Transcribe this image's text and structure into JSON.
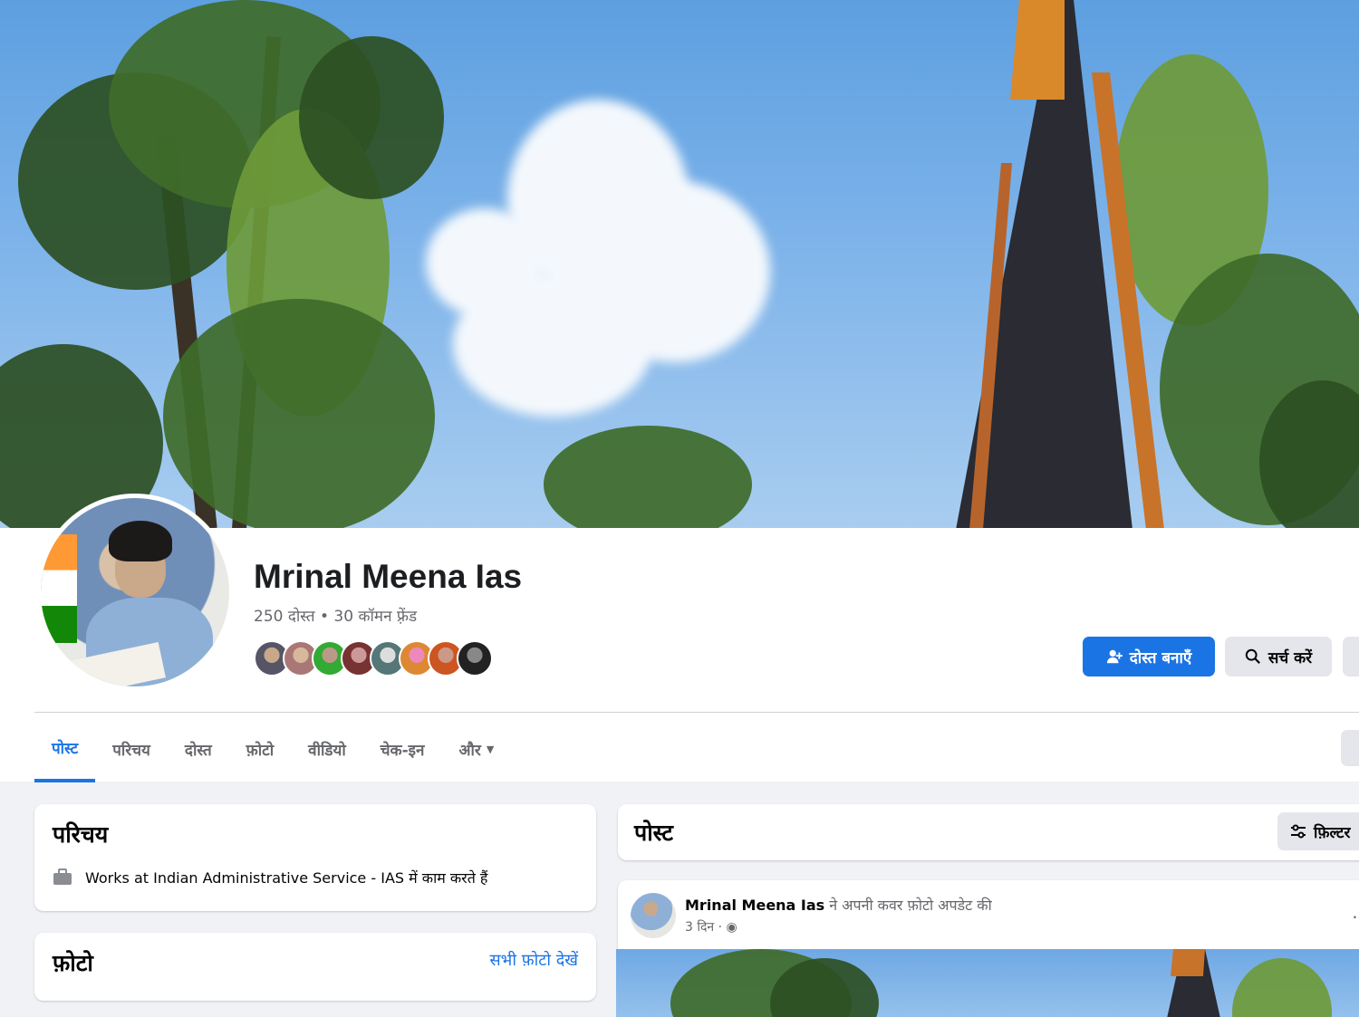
{
  "profile": {
    "name": "Mrinal Meena Ias",
    "friends_meta": "250 दोस्त • 30 कॉमन फ़्रेंड",
    "mutual_friends_count": 8
  },
  "actions": {
    "add_friend": "दोस्त बनाएँ",
    "search": "सर्च करें"
  },
  "tabs": [
    {
      "label": "पोस्ट",
      "active": true
    },
    {
      "label": "परिचय"
    },
    {
      "label": "दोस्त"
    },
    {
      "label": "फ़ोटो"
    },
    {
      "label": "वीडियो"
    },
    {
      "label": "चेक-इन"
    },
    {
      "label": "और"
    }
  ],
  "intro": {
    "title": "परिचय",
    "work": "Works at Indian Administrative Service - IAS में काम करते हैं"
  },
  "photos": {
    "title": "फ़ोटो",
    "see_all": "सभी फ़ोटो देखें"
  },
  "posts": {
    "title": "पोस्ट",
    "filter": "फ़िल्टर"
  },
  "post": {
    "author": "Mrinal Meena Ias",
    "action": "ने अपनी कवर फ़ोटो अपडेट की",
    "time": "3 दिन ·"
  },
  "colors": {
    "accent": "#1b74e4",
    "secondary_text": "#65676b",
    "page_bg": "#f0f2f5"
  },
  "icons": [
    "add-friend-icon",
    "search-icon",
    "chevron-down-icon",
    "briefcase-icon",
    "filter-icon",
    "globe-icon",
    "more-icon"
  ]
}
